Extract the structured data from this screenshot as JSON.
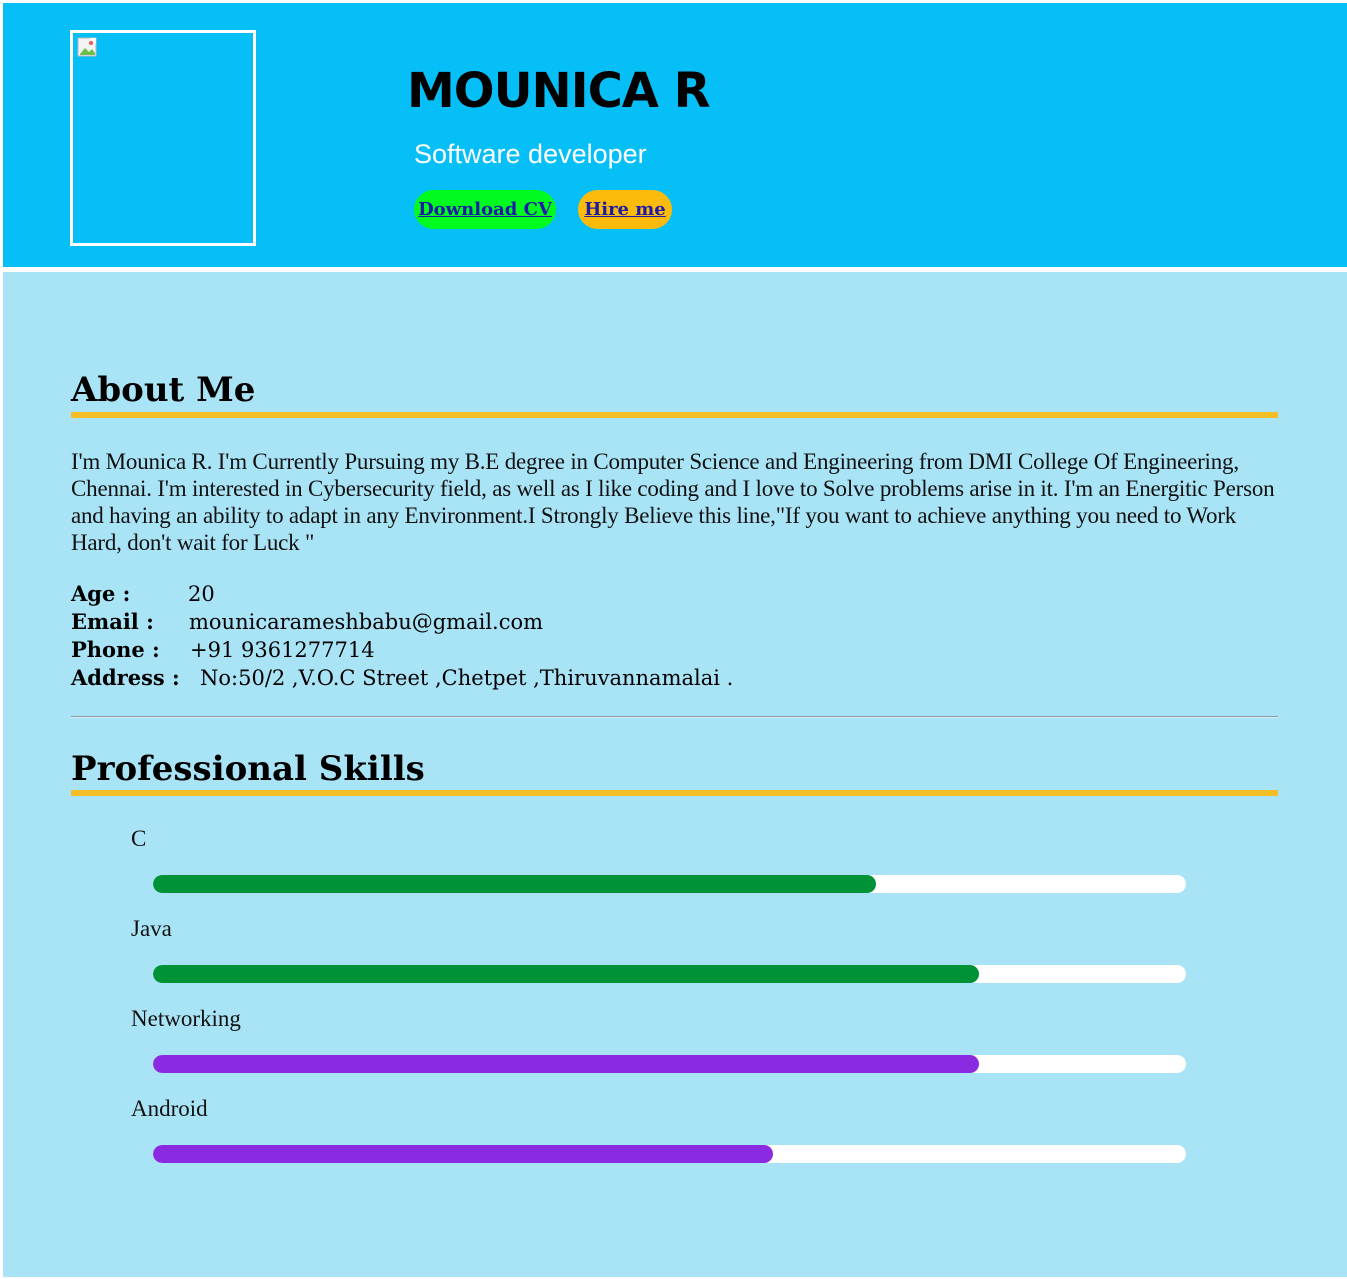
{
  "header": {
    "name": "MOUNICA R",
    "role": "Software developer",
    "buttons": {
      "download_cv": "Download CV",
      "hire_me": "Hire me"
    },
    "colors": {
      "background": "#07bff7",
      "download_button": "#00fb1e",
      "hire_button": "#fcbb0b"
    }
  },
  "about": {
    "title": "About Me",
    "paragraph": "I'm Mounica R. I'm Currently Pursuing my B.E degree in Computer Science and Engineering from DMI College Of Engineering, Chennai. I'm interested in Cybersecurity field, as well as I like coding and I love to Solve problems arise in it. I'm an Energitic Person and having an ability to adapt in any Environment.I Strongly Believe this line,\"If you want to achieve anything you need to Work Hard, don't wait for Luck \"",
    "details": [
      {
        "label": "Age :",
        "value": "20"
      },
      {
        "label": "Email :",
        "value": "mounicarameshbabu@gmail.com"
      },
      {
        "label": "Phone :",
        "value": "+91 9361277714"
      },
      {
        "label": "Address :",
        "value": "No:50/2 ,V.O.C Street ,Chetpet ,Thiruvannamalai ."
      }
    ]
  },
  "skills": {
    "title": "Professional Skills",
    "items": [
      {
        "name": "C",
        "level": 0.7,
        "color": "#009236"
      },
      {
        "name": "Java",
        "level": 0.8,
        "color": "#009236"
      },
      {
        "name": "Networking",
        "level": 0.8,
        "color": "#8a2be2"
      },
      {
        "name": "Android",
        "level": 0.6,
        "color": "#8a2be2"
      }
    ]
  },
  "colors": {
    "main_background": "#a9e3f6",
    "accent_underline": "#f5bd26"
  }
}
